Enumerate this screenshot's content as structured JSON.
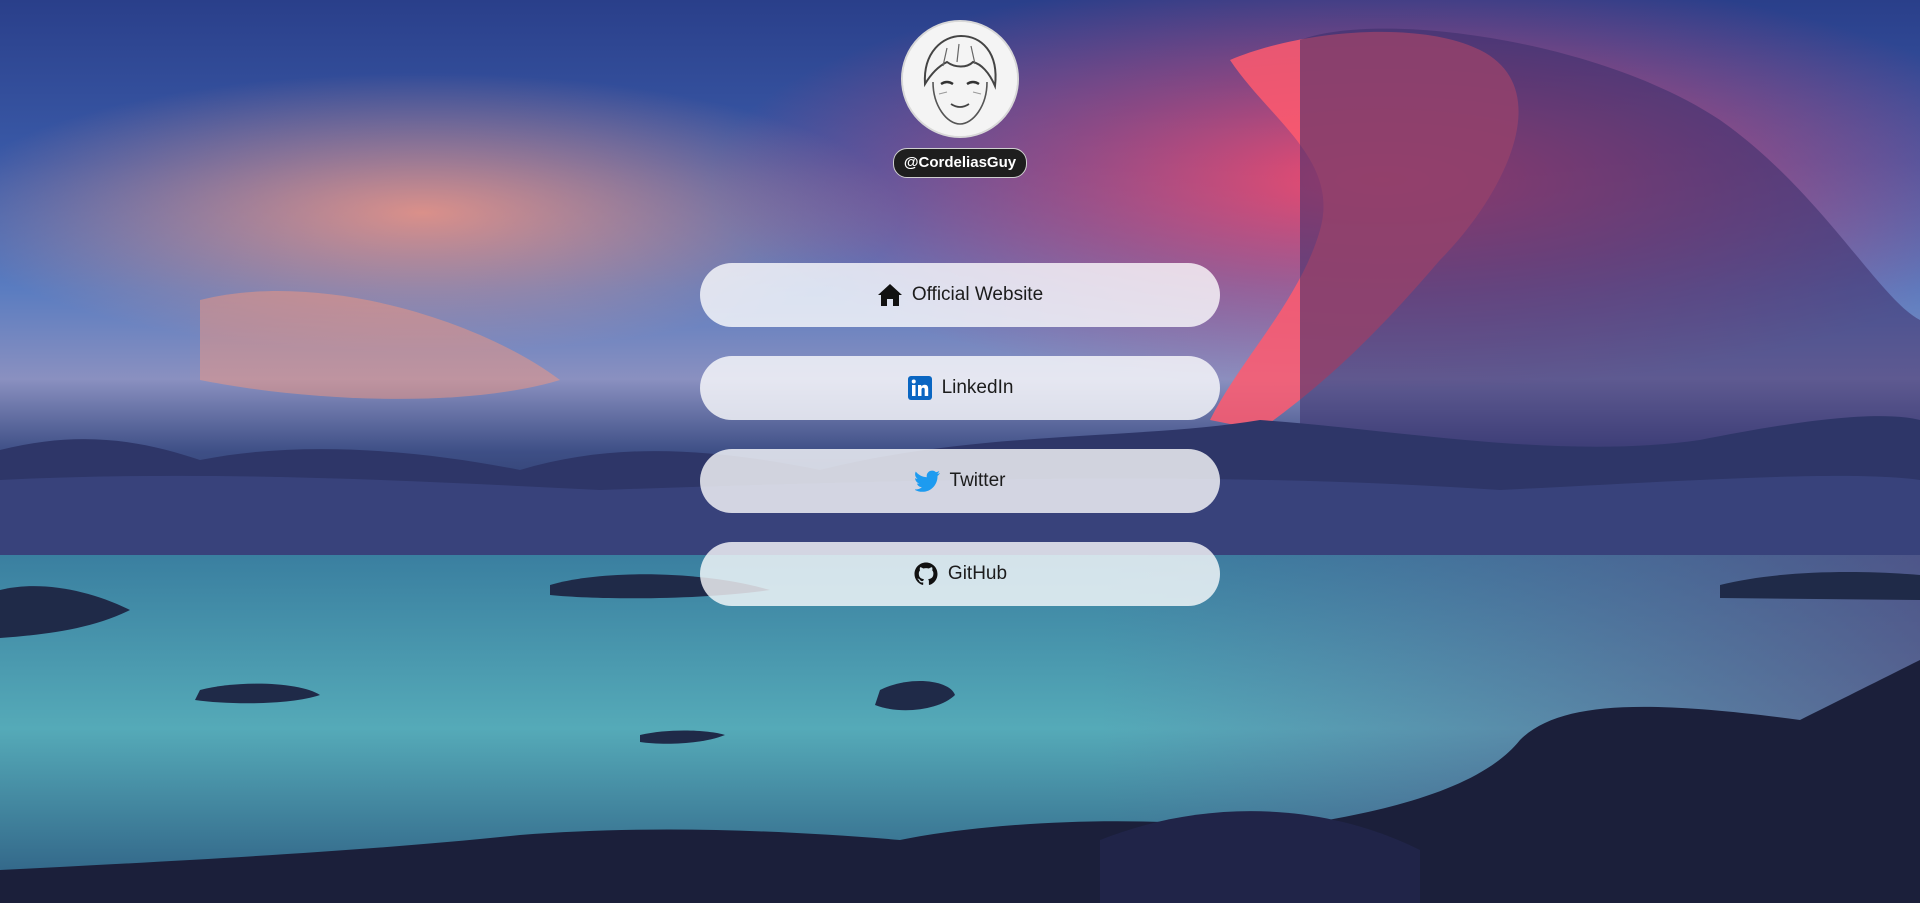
{
  "profile": {
    "handle": "@CordeliasGuy"
  },
  "links": [
    {
      "label": "Official Website",
      "icon": "home-icon"
    },
    {
      "label": "LinkedIn",
      "icon": "linkedin-icon"
    },
    {
      "label": "Twitter",
      "icon": "twitter-icon"
    },
    {
      "label": "GitHub",
      "icon": "github-icon"
    }
  ],
  "colors": {
    "link_background": "rgba(255,255,255,0.78)",
    "handle_background": "#1e1e1e",
    "linkedin_blue": "#0a66c2",
    "twitter_blue": "#1d9bf0"
  }
}
